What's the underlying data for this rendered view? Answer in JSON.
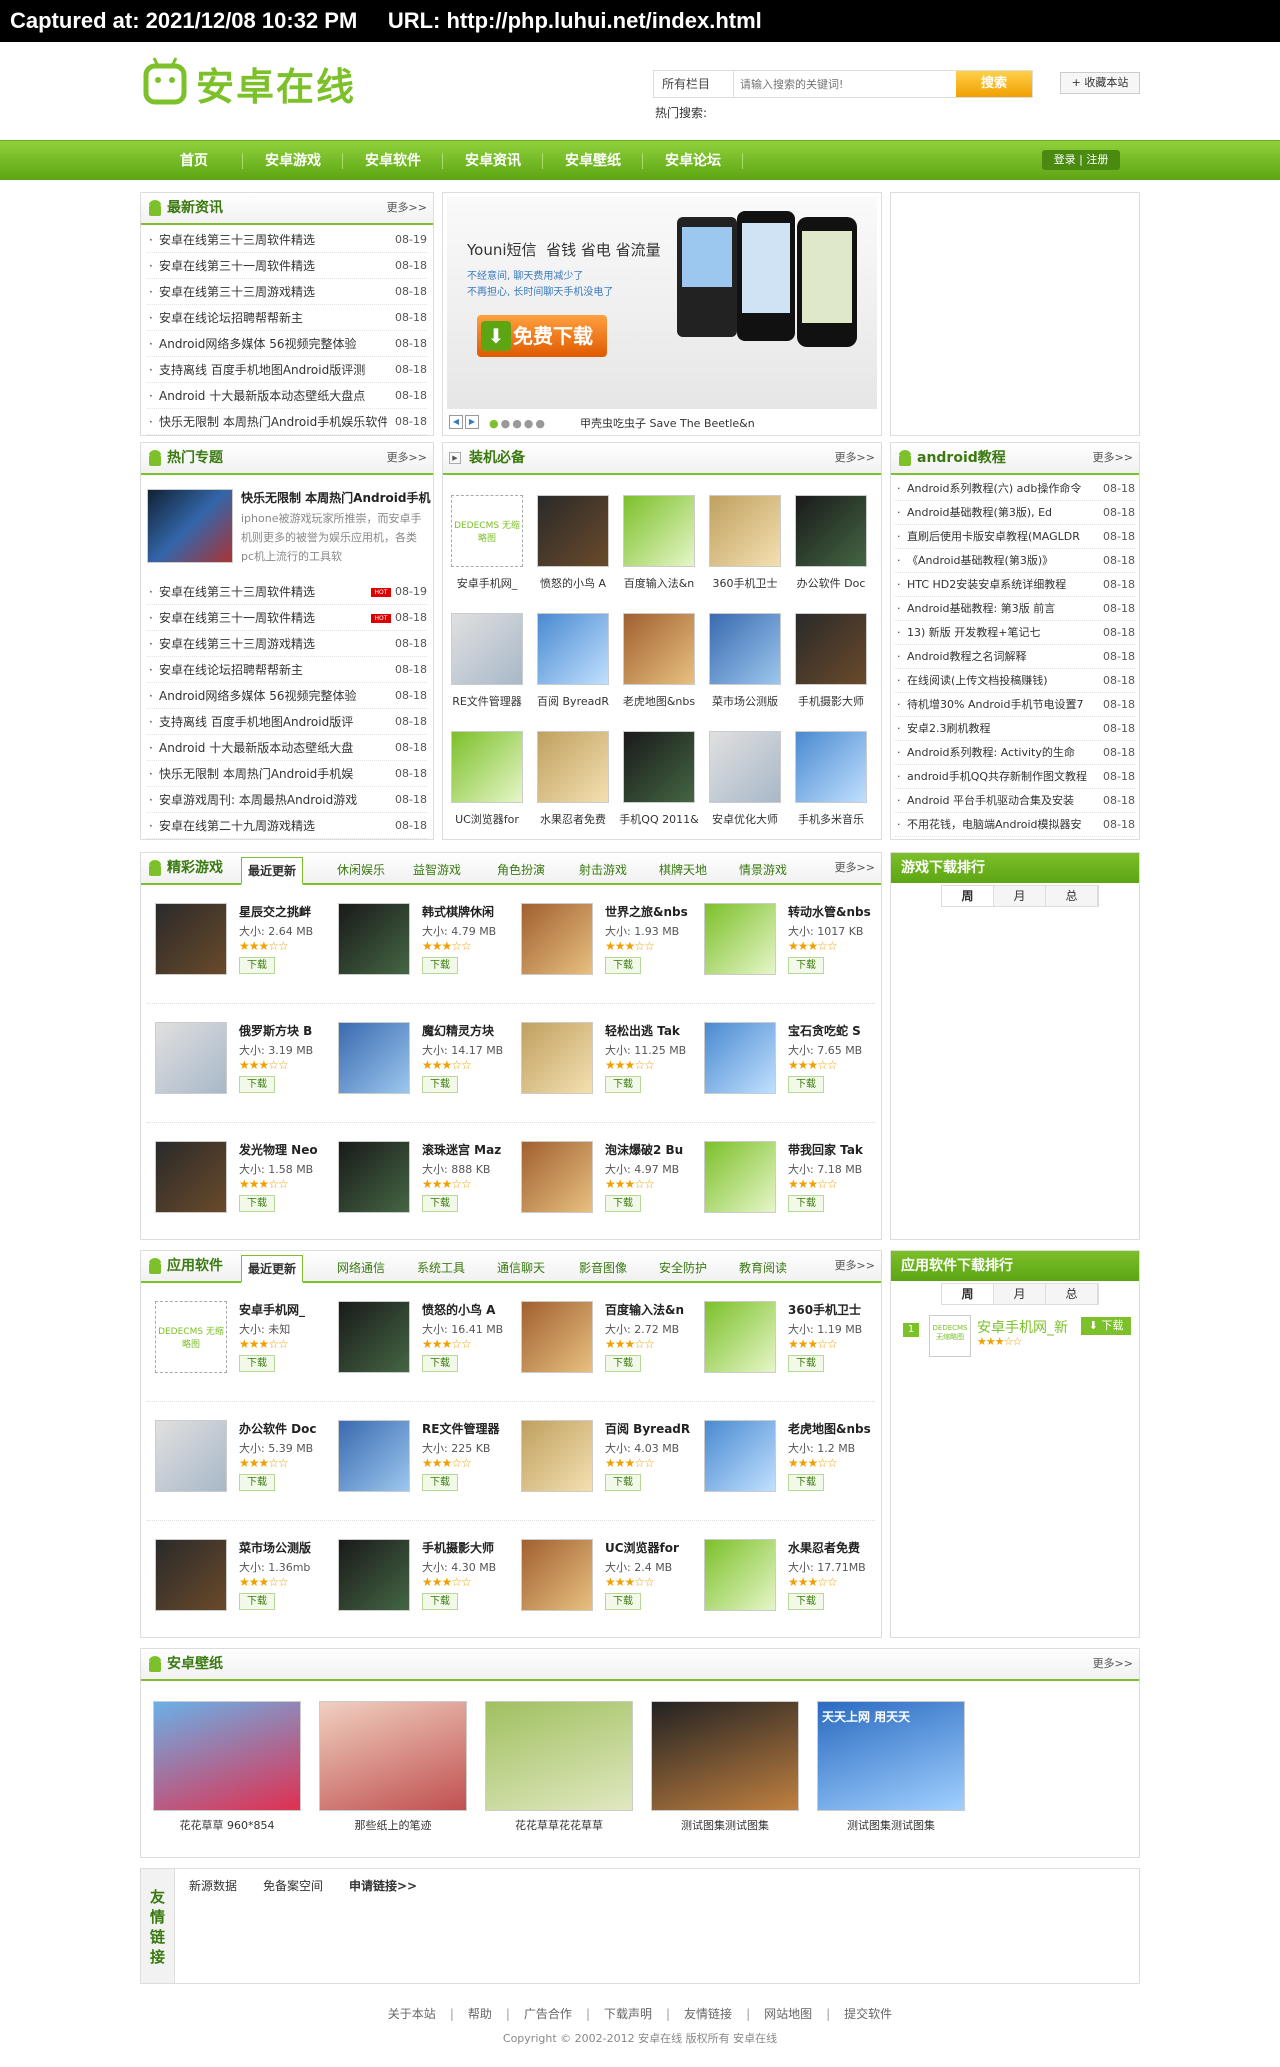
{
  "capture": "Captured at: 2021/12/08 10:32 PM     URL: http://php.luhui.net/index.html",
  "logo": "安卓在线",
  "search": {
    "scope": "所有栏目",
    "placeholder": "请输入搜索的关键词!",
    "button": "搜索"
  },
  "fav": "+ 收藏本站",
  "hot_label": "热门搜索:",
  "nav": [
    "首页",
    "安卓游戏",
    "安卓软件",
    "安卓资讯",
    "安卓壁纸",
    "安卓论坛"
  ],
  "login": "登录 | 注册",
  "more": "更多>>",
  "news": {
    "title": "最新资讯",
    "items": [
      {
        "t": "安卓在线第三十三周软件精选",
        "d": "08-19"
      },
      {
        "t": "安卓在线第三十一周软件精选",
        "d": "08-18"
      },
      {
        "t": "安卓在线第三十三周游戏精选",
        "d": "08-18"
      },
      {
        "t": "安卓在线论坛招聘帮帮新主",
        "d": "08-18"
      },
      {
        "t": "Android网络多媒体 56视频完整体验",
        "d": "08-18"
      },
      {
        "t": "支持离线 百度手机地图Android版评测",
        "d": "08-18"
      },
      {
        "t": "Android 十大最新版本动态壁纸大盘点",
        "d": "08-18"
      },
      {
        "t": "快乐无限制 本周热门Android手机娱乐软件",
        "d": "08-18"
      }
    ]
  },
  "banner": {
    "brand": "Youni短信",
    "slogan": "省钱 省电 省流量",
    "line1": "不经意间, 聊天费用减少了",
    "line2": "不再担心, 长时间聊天手机没电了",
    "btn": "免费下载",
    "caption": "甲壳虫吃虫子 Save The Beetle&n"
  },
  "topics": {
    "title": "热门专题",
    "feature_title": "快乐无限制 本周热门Android手机",
    "feature_desc": "iphone被游戏玩家所推崇，而安卓手机则更多的被誉为娱乐应用机，各类pc机上流行的工具软",
    "hot": "HOT",
    "items": [
      {
        "t": "安卓在线第三十三周软件精选",
        "d": "08-19",
        "hot": true
      },
      {
        "t": "安卓在线第三十一周软件精选",
        "d": "08-18",
        "hot": true
      },
      {
        "t": "安卓在线第三十三周游戏精选",
        "d": "08-18"
      },
      {
        "t": "安卓在线论坛招聘帮帮新主",
        "d": "08-18"
      },
      {
        "t": "Android网络多媒体 56视频完整体验",
        "d": "08-18"
      },
      {
        "t": "支持离线 百度手机地图Android版评",
        "d": "08-18"
      },
      {
        "t": "Android 十大最新版本动态壁纸大盘",
        "d": "08-18"
      },
      {
        "t": "快乐无限制 本周热门Android手机娱",
        "d": "08-18"
      },
      {
        "t": "安卓游戏周刊: 本周最热Android游戏",
        "d": "08-18"
      },
      {
        "t": "安卓在线第二十九周游戏精选",
        "d": "08-18"
      }
    ]
  },
  "must": {
    "title": "装机必备",
    "items": [
      "安卓手机网_",
      "愤怒的小鸟 A",
      "百度输入法&n",
      "360手机卫士",
      "办公软件 Doc",
      "RE文件管理器",
      "百阅 ByreadR",
      "老虎地图&nbs",
      "菜市场公测版",
      "手机摄影大师",
      "UC浏览器for",
      "水果忍者免费",
      "手机QQ 2011&",
      "安卓优化大师",
      "手机多米音乐"
    ]
  },
  "tutorial": {
    "title": "android教程",
    "items": [
      {
        "t": "Android系列教程(六) adb操作命令",
        "d": "08-18"
      },
      {
        "t": "Android基础教程(第3版), Ed",
        "d": "08-18"
      },
      {
        "t": "直刷后使用卡版安卓教程(MAGLDR",
        "d": "08-18"
      },
      {
        "t": "《Android基础教程(第3版)》",
        "d": "08-18"
      },
      {
        "t": "HTC HD2安装安卓系统详细教程",
        "d": "08-18"
      },
      {
        "t": "Android基础教程: 第3版 前言",
        "d": "08-18"
      },
      {
        "t": "13) 新版 开发教程+笔记七",
        "d": "08-18"
      },
      {
        "t": "Android教程之名词解释",
        "d": "08-18"
      },
      {
        "t": "在线阅读(上传文档投稿赚钱)",
        "d": "08-18"
      },
      {
        "t": "待机增30% Android手机节电设置7",
        "d": "08-18"
      },
      {
        "t": "安卓2.3刷机教程",
        "d": "08-18"
      },
      {
        "t": "Android系列教程: Activity的生命",
        "d": "08-18"
      },
      {
        "t": "android手机QQ共存新制作图文教程",
        "d": "08-18"
      },
      {
        "t": "Android 平台手机驱动合集及安装",
        "d": "08-18"
      },
      {
        "t": "不用花钱，电脑端Android模拟器安",
        "d": "08-18"
      }
    ]
  },
  "games": {
    "title": "精彩游戏",
    "tabs": [
      "最近更新",
      "休闲娱乐",
      "益智游戏",
      "角色扮演",
      "射击游戏",
      "棋牌天地",
      "情景游戏"
    ],
    "items": [
      {
        "n": "星辰交之挑衅",
        "s": "大小: 2.64 MB"
      },
      {
        "n": "韩式棋牌休闲",
        "s": "大小: 4.79 MB"
      },
      {
        "n": "世界之旅&nbs",
        "s": "大小: 1.93 MB"
      },
      {
        "n": "转动水管&nbs",
        "s": "大小: 1017 KB"
      },
      {
        "n": "俄罗斯方块 B",
        "s": "大小: 3.19 MB"
      },
      {
        "n": "魔幻精灵方块",
        "s": "大小: 14.17 MB"
      },
      {
        "n": "轻松出逃 Tak",
        "s": "大小: 11.25 MB"
      },
      {
        "n": "宝石贪吃蛇 S",
        "s": "大小: 7.65 MB"
      },
      {
        "n": "发光物理 Neo",
        "s": "大小: 1.58 MB"
      },
      {
        "n": "滚珠迷宫 Maz",
        "s": "大小: 888 KB"
      },
      {
        "n": "泡沫爆破2 Bu",
        "s": "大小: 4.97 MB"
      },
      {
        "n": "带我回家 Tak",
        "s": "大小: 7.18 MB"
      }
    ]
  },
  "download": "下载",
  "game_rank": {
    "title": "游戏下载排行",
    "tabs": [
      "周",
      "月",
      "总"
    ]
  },
  "apps": {
    "title": "应用软件",
    "tabs": [
      "最近更新",
      "网络通信",
      "系统工具",
      "通信聊天",
      "影音图像",
      "安全防护",
      "教育阅读"
    ],
    "items": [
      {
        "n": "安卓手机网_",
        "s": "大小: 未知"
      },
      {
        "n": "愤怒的小鸟 A",
        "s": "大小: 16.41 MB"
      },
      {
        "n": "百度输入法&n",
        "s": "大小: 2.72 MB"
      },
      {
        "n": "360手机卫士",
        "s": "大小: 1.19 MB"
      },
      {
        "n": "办公软件 Doc",
        "s": "大小: 5.39 MB"
      },
      {
        "n": "RE文件管理器",
        "s": "大小: 225 KB"
      },
      {
        "n": "百阅 ByreadR",
        "s": "大小: 4.03 MB"
      },
      {
        "n": "老虎地图&nbs",
        "s": "大小: 1.2 MB"
      },
      {
        "n": "菜市场公测版",
        "s": "大小: 1.36mb"
      },
      {
        "n": "手机摄影大师",
        "s": "大小: 4.30 MB"
      },
      {
        "n": "UC浏览器for",
        "s": "大小: 2.4 MB"
      },
      {
        "n": "水果忍者免费",
        "s": "大小: 17.71MB"
      }
    ]
  },
  "app_rank": {
    "title": "应用软件下载排行",
    "tabs": [
      "周",
      "月",
      "总"
    ],
    "first": {
      "rank": "1",
      "name": "安卓手机网_新",
      "btn": "下载"
    }
  },
  "dede": "DEDECMS 无缩略图",
  "wallpaper": {
    "title": "安卓壁纸",
    "items": [
      "花花草草 960*854",
      "那些纸上的笔迹",
      "花花草草花花草草",
      "测试图集测试图集",
      "测试图集测试图集"
    ],
    "ad": "天天上网 用天天"
  },
  "links": {
    "title": "友情链接",
    "items": [
      "新源数据",
      "免备案空间",
      "申请链接>>"
    ]
  },
  "footer": {
    "links": [
      "关于本站",
      "帮助",
      "广告合作",
      "下载声明",
      "友情链接",
      "网站地图",
      "提交软件"
    ],
    "copy": "Copyright © 2002-2012 安卓在线 版权所有      安卓在线"
  },
  "colors": {
    "green": "#7cc02a",
    "dark_green": "#3a7a10",
    "orange": "#f0a000"
  }
}
